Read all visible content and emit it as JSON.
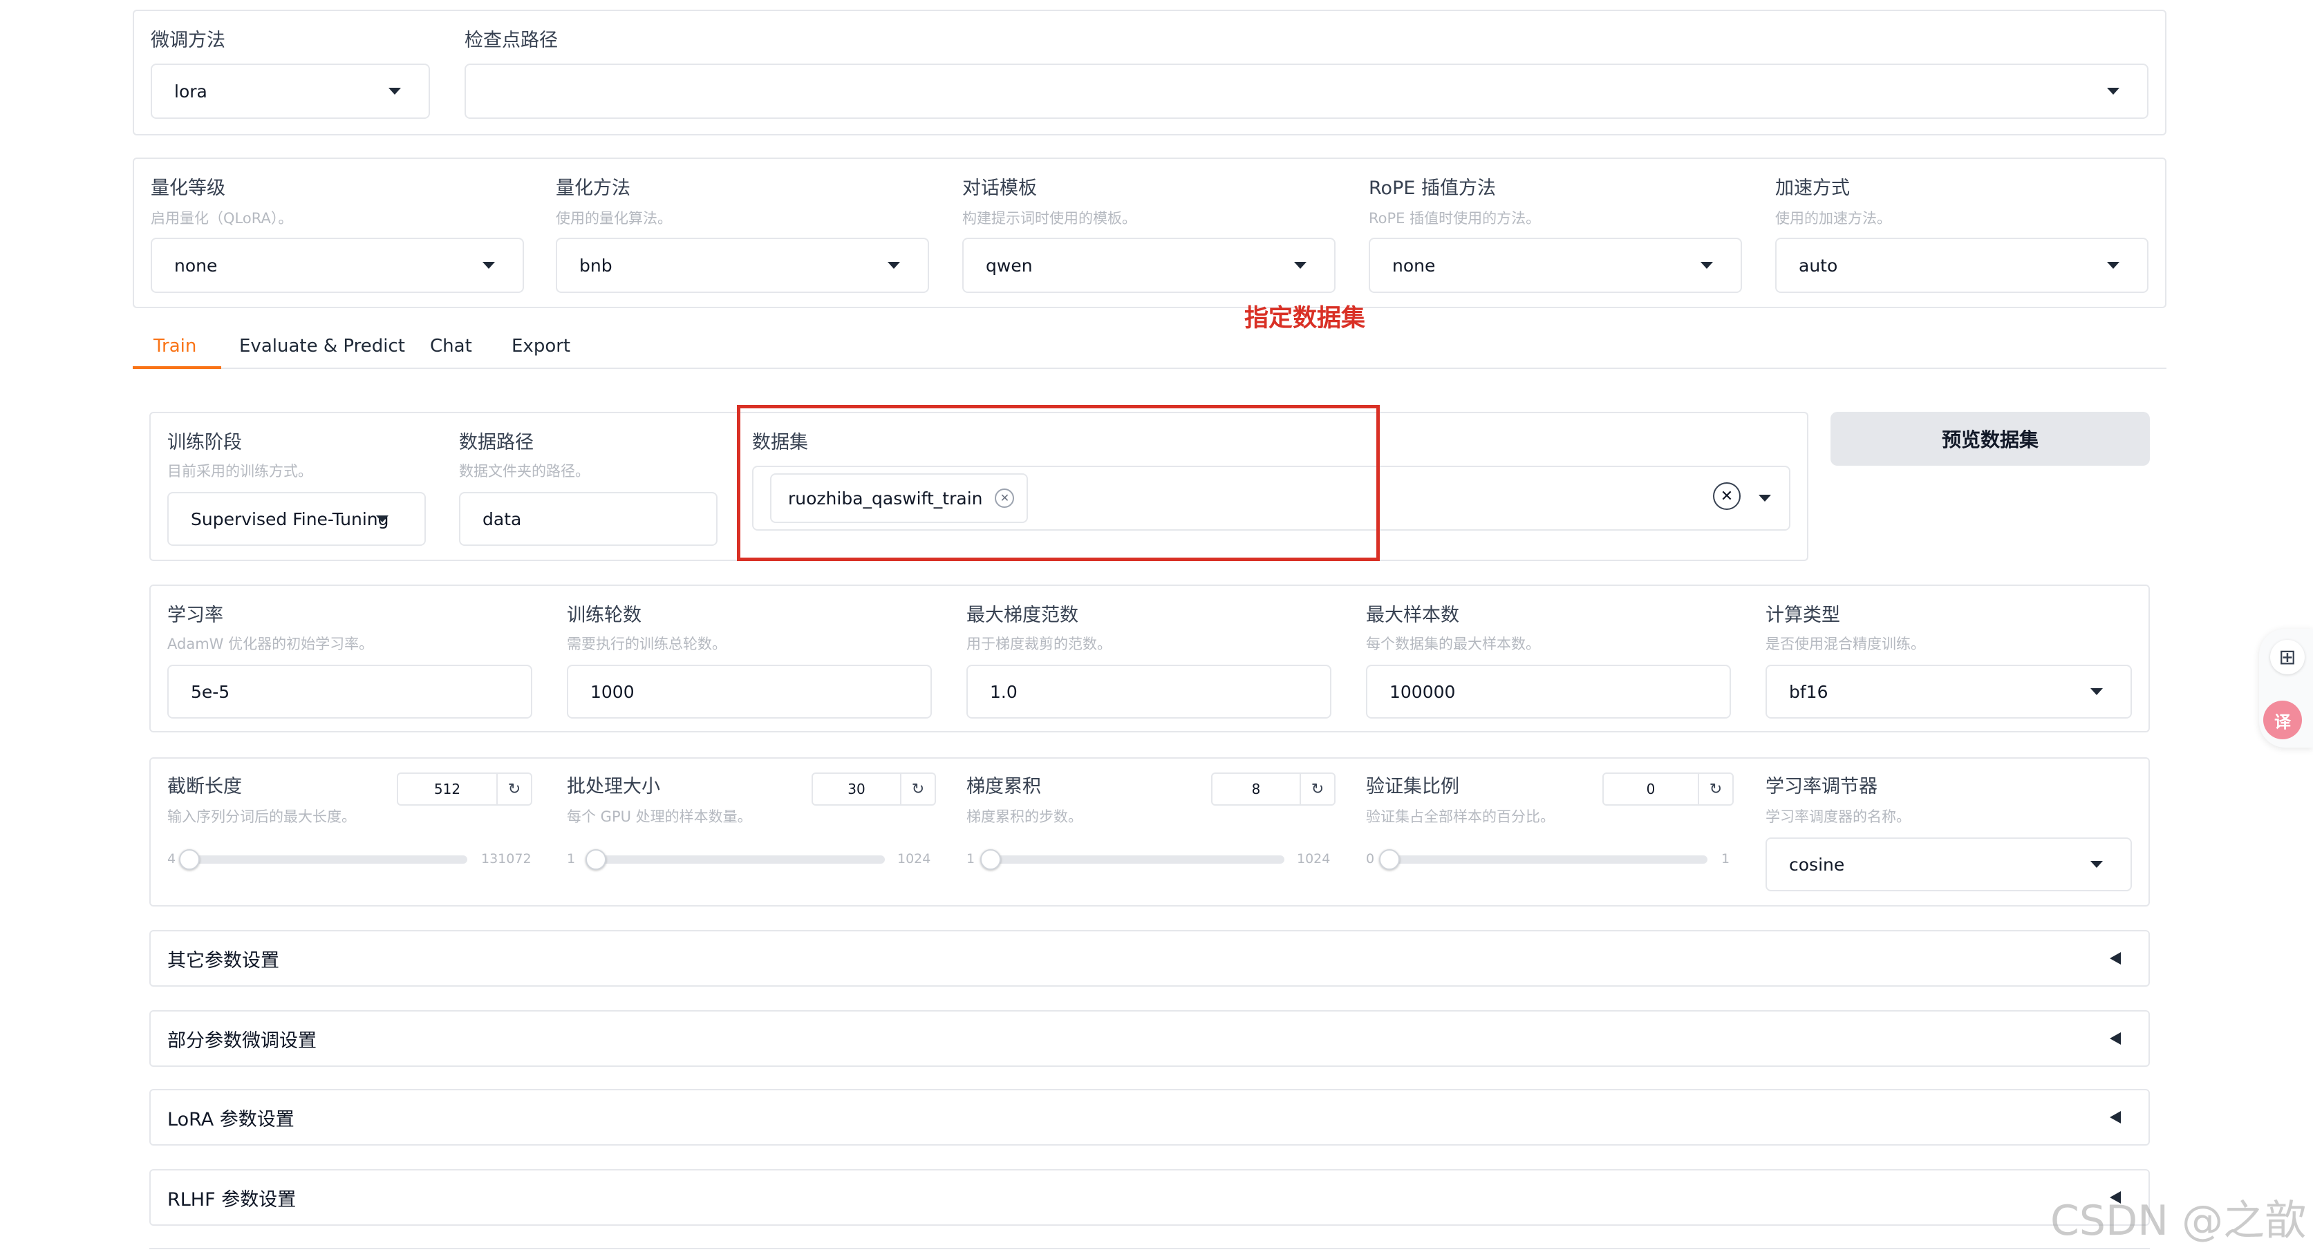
{
  "top": {
    "finetune_label": "微调方法",
    "finetune_value": "lora",
    "checkpoint_label": "检查点路径",
    "checkpoint_value": ""
  },
  "quant_row": [
    {
      "label": "量化等级",
      "info": "启用量化（QLoRA）。",
      "value": "none"
    },
    {
      "label": "量化方法",
      "info": "使用的量化算法。",
      "value": "bnb"
    },
    {
      "label": "对话模板",
      "info": "构建提示词时使用的模板。",
      "value": "qwen"
    },
    {
      "label": "RoPE 插值方法",
      "info": "RoPE 插值时使用的方法。",
      "value": "none"
    },
    {
      "label": "加速方式",
      "info": "使用的加速方法。",
      "value": "auto"
    }
  ],
  "annotation": {
    "text": "指定数据集",
    "color": "#d93025"
  },
  "tabs": [
    {
      "label": "Train",
      "active": true
    },
    {
      "label": "Evaluate & Predict",
      "active": false
    },
    {
      "label": "Chat",
      "active": false
    },
    {
      "label": "Export",
      "active": false
    }
  ],
  "train": {
    "stage_label": "训练阶段",
    "stage_info": "目前采用的训练方式。",
    "stage_value": "Supervised Fine-Tuning",
    "dir_label": "数据路径",
    "dir_info": "数据文件夹的路径。",
    "dir_value": "data",
    "dataset_label": "数据集",
    "dataset_chip": "ruozhiba_qaswift_train",
    "preview_button": "预览数据集"
  },
  "hparams": [
    {
      "label": "学习率",
      "info": "AdamW 优化器的初始学习率。",
      "value": "5e-5"
    },
    {
      "label": "训练轮数",
      "info": "需要执行的训练总轮数。",
      "value": "1000"
    },
    {
      "label": "最大梯度范数",
      "info": "用于梯度裁剪的范数。",
      "value": "1.0"
    },
    {
      "label": "最大样本数",
      "info": "每个数据集的最大样本数。",
      "value": "100000"
    },
    {
      "label": "计算类型",
      "info": "是否使用混合精度训练。",
      "value": "bf16"
    }
  ],
  "sliders": [
    {
      "label": "截断长度",
      "info": "输入序列分词后的最大长度。",
      "value": "512",
      "min": "4",
      "max": "131072",
      "fraction": 0.004
    },
    {
      "label": "批处理大小",
      "info": "每个 GPU 处理的样本数量。",
      "value": "30",
      "min": "1",
      "max": "1024",
      "fraction": 0.028
    },
    {
      "label": "梯度累积",
      "info": "梯度累积的步数。",
      "value": "8",
      "min": "1",
      "max": "1024",
      "fraction": 0.007
    },
    {
      "label": "验证集比例",
      "info": "验证集占全部样本的百分比。",
      "value": "0",
      "min": "0",
      "max": "1",
      "fraction": 0.0
    }
  ],
  "scheduler": {
    "label": "学习率调节器",
    "info": "学习率调度器的名称。",
    "value": "cosine"
  },
  "accordions": [
    "其它参数设置",
    "部分参数微调设置",
    "LoRA 参数设置",
    "RLHF 参数设置"
  ],
  "watermark": "CSDN @之歆",
  "colors": {
    "accent": "#f97316",
    "annotation": "#d93025",
    "border": "#e5e7eb"
  }
}
